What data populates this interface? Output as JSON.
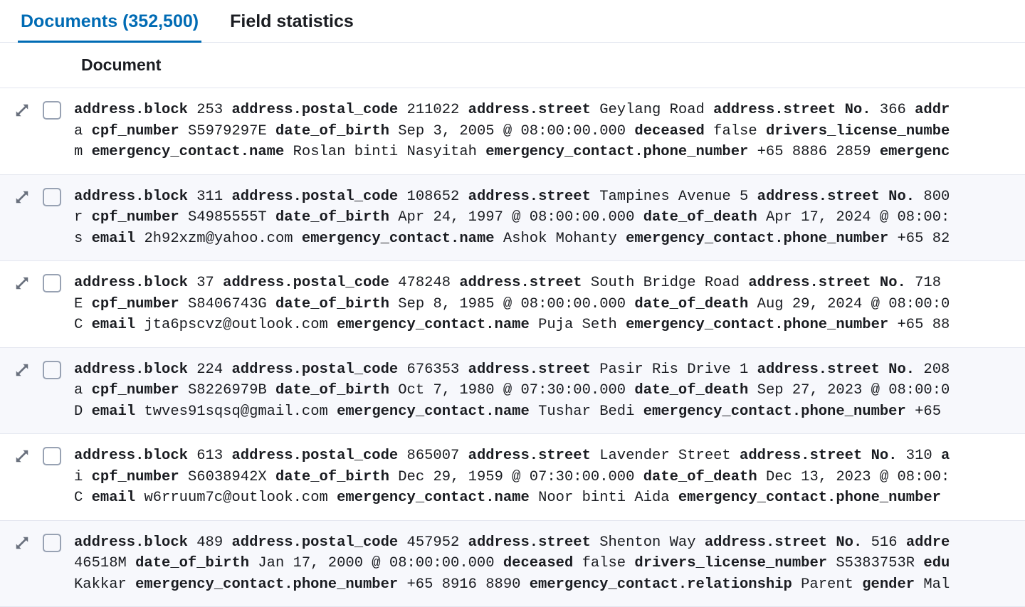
{
  "tabs": {
    "documents_label": "Documents (352,500)",
    "field_stats_label": "Field statistics"
  },
  "column_header": "Document",
  "rows": [
    {
      "lines": [
        [
          {
            "f": "address.block",
            "v": "253"
          },
          {
            "f": "address.postal_code",
            "v": "211022"
          },
          {
            "f": "address.street",
            "v": "Geylang Road"
          },
          {
            "f": "address.street No.",
            "v": "366"
          },
          {
            "f": "addr",
            "v": ""
          }
        ],
        [
          {
            "f": "",
            "v": "a"
          },
          {
            "f": "cpf_number",
            "v": "S5979297E"
          },
          {
            "f": "date_of_birth",
            "v": "Sep 3, 2005 @ 08:00:00.000"
          },
          {
            "f": "deceased",
            "v": "false"
          },
          {
            "f": "drivers_license_numbe",
            "v": ""
          }
        ],
        [
          {
            "f": "",
            "v": "m"
          },
          {
            "f": "emergency_contact.name",
            "v": "Roslan binti Nasyitah"
          },
          {
            "f": "emergency_contact.phone_number",
            "v": "+65 8886 2859"
          },
          {
            "f": "emergenc",
            "v": ""
          }
        ]
      ]
    },
    {
      "lines": [
        [
          {
            "f": "address.block",
            "v": "311"
          },
          {
            "f": "address.postal_code",
            "v": "108652"
          },
          {
            "f": "address.street",
            "v": "Tampines Avenue 5"
          },
          {
            "f": "address.street No.",
            "v": "800"
          }
        ],
        [
          {
            "f": "",
            "v": "r"
          },
          {
            "f": "cpf_number",
            "v": "S4985555T"
          },
          {
            "f": "date_of_birth",
            "v": "Apr 24, 1997 @ 08:00:00.000"
          },
          {
            "f": "date_of_death",
            "v": "Apr 17, 2024 @ 08:00:"
          }
        ],
        [
          {
            "f": "",
            "v": "s"
          },
          {
            "f": "email",
            "v": "2h92xzm@yahoo.com"
          },
          {
            "f": "emergency_contact.name",
            "v": "Ashok Mohanty"
          },
          {
            "f": "emergency_contact.phone_number",
            "v": "+65 82"
          }
        ]
      ]
    },
    {
      "lines": [
        [
          {
            "f": "address.block",
            "v": "37"
          },
          {
            "f": "address.postal_code",
            "v": "478248"
          },
          {
            "f": "address.street",
            "v": "South Bridge Road"
          },
          {
            "f": "address.street No.",
            "v": "718"
          }
        ],
        [
          {
            "f": "",
            "v": "E"
          },
          {
            "f": "cpf_number",
            "v": "S8406743G"
          },
          {
            "f": "date_of_birth",
            "v": "Sep 8, 1985 @ 08:00:00.000"
          },
          {
            "f": "date_of_death",
            "v": "Aug 29, 2024 @ 08:00:0"
          }
        ],
        [
          {
            "f": "",
            "v": "C"
          },
          {
            "f": "email",
            "v": "jta6pscvz@outlook.com"
          },
          {
            "f": "emergency_contact.name",
            "v": "Puja Seth"
          },
          {
            "f": "emergency_contact.phone_number",
            "v": "+65 88"
          }
        ]
      ]
    },
    {
      "lines": [
        [
          {
            "f": "address.block",
            "v": "224"
          },
          {
            "f": "address.postal_code",
            "v": "676353"
          },
          {
            "f": "address.street",
            "v": "Pasir Ris Drive 1"
          },
          {
            "f": "address.street No.",
            "v": "208"
          }
        ],
        [
          {
            "f": "",
            "v": "a"
          },
          {
            "f": "cpf_number",
            "v": "S8226979B"
          },
          {
            "f": "date_of_birth",
            "v": "Oct 7, 1980 @ 07:30:00.000"
          },
          {
            "f": "date_of_death",
            "v": "Sep 27, 2023 @ 08:00:0"
          }
        ],
        [
          {
            "f": "",
            "v": "D"
          },
          {
            "f": "email",
            "v": "twves91sqsq@gmail.com"
          },
          {
            "f": "emergency_contact.name",
            "v": "Tushar Bedi"
          },
          {
            "f": "emergency_contact.phone_number",
            "v": "+65"
          }
        ]
      ]
    },
    {
      "lines": [
        [
          {
            "f": "address.block",
            "v": "613"
          },
          {
            "f": "address.postal_code",
            "v": "865007"
          },
          {
            "f": "address.street",
            "v": "Lavender Street"
          },
          {
            "f": "address.street No.",
            "v": "310"
          },
          {
            "f": "a",
            "v": ""
          }
        ],
        [
          {
            "f": "",
            "v": "i"
          },
          {
            "f": "cpf_number",
            "v": "S6038942X"
          },
          {
            "f": "date_of_birth",
            "v": "Dec 29, 1959 @ 07:30:00.000"
          },
          {
            "f": "date_of_death",
            "v": "Dec 13, 2023 @ 08:00:"
          }
        ],
        [
          {
            "f": "",
            "v": "C"
          },
          {
            "f": "email",
            "v": "w6rruum7c@outlook.com"
          },
          {
            "f": "emergency_contact.name",
            "v": "Noor binti Aida"
          },
          {
            "f": "emergency_contact.phone_number",
            "v": ""
          }
        ]
      ]
    },
    {
      "lines": [
        [
          {
            "f": "address.block",
            "v": "489"
          },
          {
            "f": "address.postal_code",
            "v": "457952"
          },
          {
            "f": "address.street",
            "v": "Shenton Way"
          },
          {
            "f": "address.street No.",
            "v": "516"
          },
          {
            "f": "addre",
            "v": ""
          }
        ],
        [
          {
            "f": "",
            "v": "46518M"
          },
          {
            "f": "date_of_birth",
            "v": "Jan 17, 2000 @ 08:00:00.000"
          },
          {
            "f": "deceased",
            "v": "false"
          },
          {
            "f": "drivers_license_number",
            "v": "S5383753R"
          },
          {
            "f": "edu",
            "v": ""
          }
        ],
        [
          {
            "f": "",
            "v": "Kakkar"
          },
          {
            "f": "emergency_contact.phone_number",
            "v": "+65 8916 8890"
          },
          {
            "f": "emergency_contact.relationship",
            "v": "Parent"
          },
          {
            "f": "gender",
            "v": "Mal"
          }
        ]
      ]
    }
  ]
}
